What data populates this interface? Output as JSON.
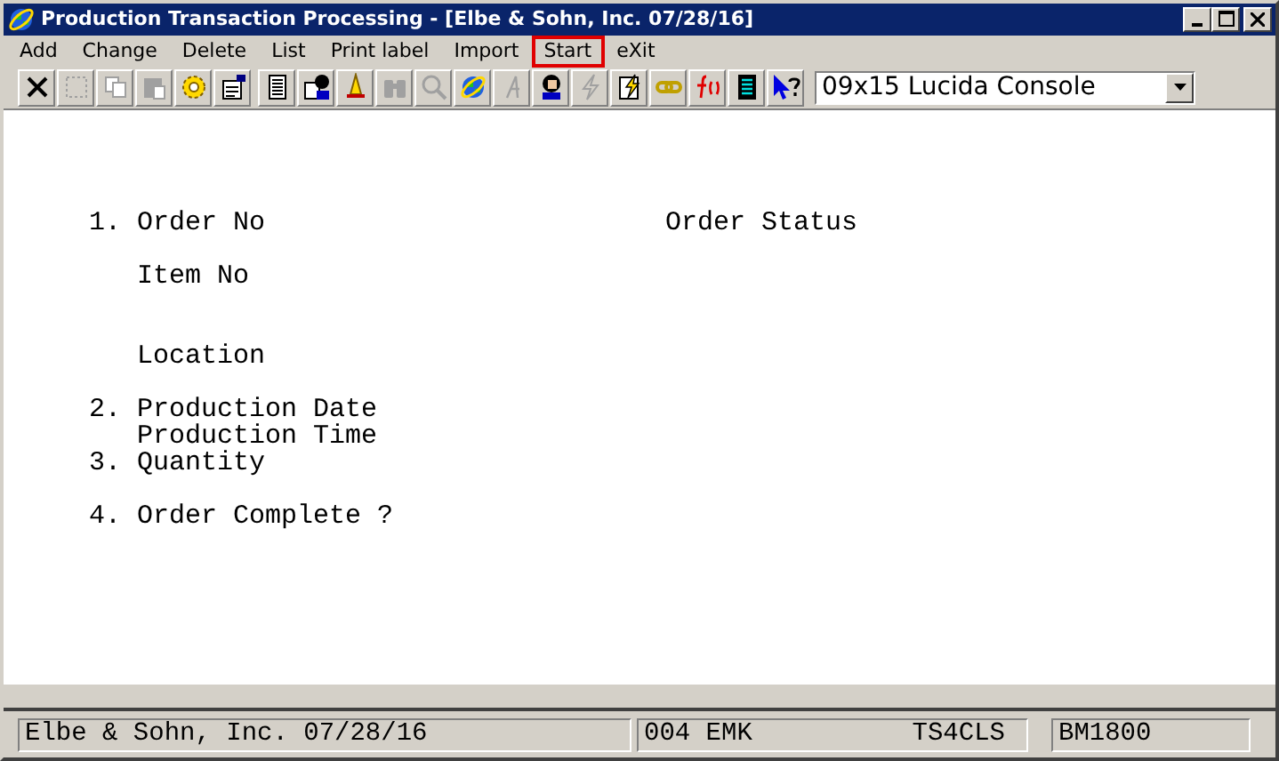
{
  "window": {
    "title": "Production Transaction Processing - [Elbe & Sohn, Inc. 07/28/16]"
  },
  "menu": [
    {
      "label": "Add",
      "highlighted": false
    },
    {
      "label": "Change",
      "highlighted": false
    },
    {
      "label": "Delete",
      "highlighted": false
    },
    {
      "label": "List",
      "highlighted": false
    },
    {
      "label": "Print label",
      "highlighted": false
    },
    {
      "label": "Import",
      "highlighted": false
    },
    {
      "label": "Start",
      "highlighted": true
    },
    {
      "label": "eXit",
      "highlighted": false
    }
  ],
  "toolbar": [
    {
      "kind": "x",
      "disabled": false
    },
    {
      "kind": "select",
      "disabled": true
    },
    {
      "kind": "copy",
      "disabled": true
    },
    {
      "kind": "paste",
      "disabled": true
    },
    {
      "kind": "gear",
      "disabled": false
    },
    {
      "kind": "form",
      "disabled": false
    },
    {
      "kind": "separator"
    },
    {
      "kind": "document",
      "disabled": false
    },
    {
      "kind": "person-document",
      "disabled": false
    },
    {
      "kind": "bell",
      "disabled": false
    },
    {
      "kind": "binoculars",
      "disabled": true
    },
    {
      "kind": "magnifier",
      "disabled": true
    },
    {
      "kind": "globe",
      "disabled": false
    },
    {
      "kind": "script",
      "disabled": true
    },
    {
      "kind": "person",
      "disabled": false
    },
    {
      "kind": "lightning",
      "disabled": true
    },
    {
      "kind": "lightning-document",
      "disabled": false
    },
    {
      "kind": "chain",
      "disabled": false
    },
    {
      "kind": "function",
      "disabled": false
    },
    {
      "kind": "calculator",
      "disabled": false
    },
    {
      "kind": "help",
      "disabled": false
    }
  ],
  "font_select": {
    "value": "09x15 Lucida Console"
  },
  "form": {
    "status_label": "Order Status",
    "fields": [
      {
        "number": "1.",
        "label": "Order No"
      },
      {
        "label": "Item No"
      },
      {
        "label": "Location"
      },
      {
        "number": "2.",
        "label": "Production Date"
      },
      {
        "label": "Production Time"
      },
      {
        "number": "3.",
        "label": "Quantity"
      },
      {
        "number": "4.",
        "label": "Order Complete ?"
      }
    ]
  },
  "status_bar": {
    "company": "Elbe & Sohn, Inc. 07/28/16",
    "user": "004 EMK",
    "terminal": "TS4CLS",
    "program": "BM1800"
  }
}
